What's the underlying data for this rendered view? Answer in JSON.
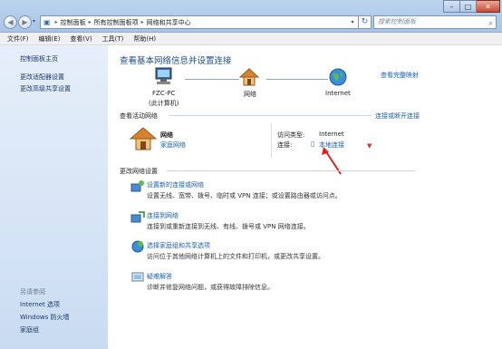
{
  "window": {
    "address": [
      "控制面板",
      "所有控制面板项",
      "网络和共享中心"
    ],
    "search_placeholder": "搜索控制面板",
    "min": "–",
    "max": "□",
    "close": "✕"
  },
  "menu": [
    "文件(F)",
    "编辑(E)",
    "查看(V)",
    "工具(T)",
    "帮助(H)"
  ],
  "sidebar": {
    "items": [
      "控制面板主页",
      "更改适配器设置",
      "更改高级共享设置"
    ],
    "see_also_title": "另请参阅",
    "see_also": [
      "Internet 选项",
      "Windows 防火墙",
      "家庭组"
    ]
  },
  "main": {
    "heading": "查看基本网络信息并设置连接",
    "view_full_map": "查看完整映射",
    "map": {
      "pc_name": "FZC-PC",
      "pc_sub": "(此计算机)",
      "network": "网络",
      "internet": "Internet"
    },
    "active_title": "查看活动网络",
    "connect_disconnect": "连接或断开连接",
    "active_network": {
      "name": "网络",
      "type": "家庭网络",
      "access_label": "访问类型:",
      "access_value": "Internet",
      "conn_label": "连接:",
      "conn_value": "本地连接"
    },
    "change_title": "更改网络设置",
    "tasks": [
      {
        "title": "设置新的连接或网络",
        "desc": "设置无线、宽带、拨号、临时或 VPN 连接；或设置路由器或访问点。"
      },
      {
        "title": "连接到网络",
        "desc": "连接到或重新连接到无线、有线、拨号或 VPN 网络连接。"
      },
      {
        "title": "选择家庭组和共享选项",
        "desc": "访问位于其他网络计算机上的文件和打印机，或更改共享设置。"
      },
      {
        "title": "疑难解答",
        "desc": "诊断并修复网络问题，或获得故障排除信息。"
      }
    ]
  }
}
